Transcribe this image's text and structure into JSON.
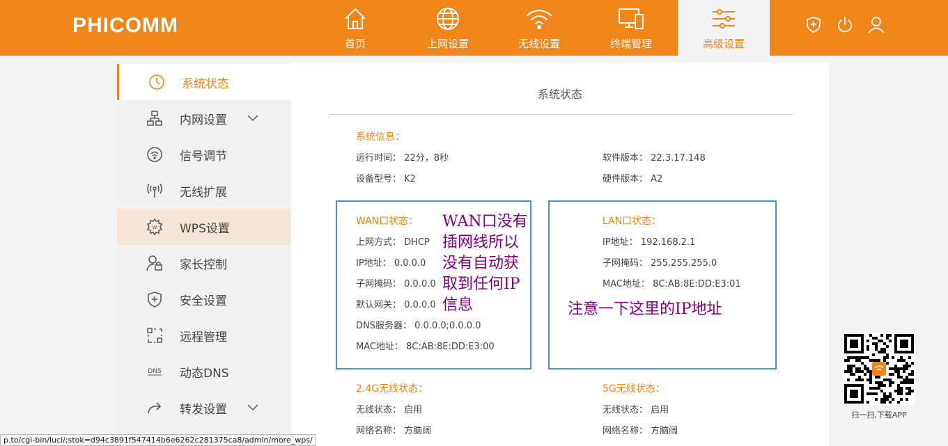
{
  "brand": {
    "logo": "PHICOMM",
    "accent": "#f08519"
  },
  "nav": [
    {
      "label": "首页",
      "icon": "home-icon"
    },
    {
      "label": "上网设置",
      "icon": "globe-icon"
    },
    {
      "label": "无线设置",
      "icon": "wifi-icon"
    },
    {
      "label": "终端管理",
      "icon": "devices-icon"
    },
    {
      "label": "高级设置",
      "icon": "sliders-icon",
      "active": true
    }
  ],
  "header_icons": [
    "shield-icon",
    "power-icon",
    "user-icon"
  ],
  "sidebar": [
    {
      "label": "系统状态",
      "icon": "clock-icon",
      "active": true
    },
    {
      "label": "内网设置",
      "icon": "network-icon",
      "expandable": true
    },
    {
      "label": "信号调节",
      "icon": "signal-icon"
    },
    {
      "label": "无线扩展",
      "icon": "antenna-icon"
    },
    {
      "label": "WPS设置",
      "icon": "gear-icon",
      "hover": true
    },
    {
      "label": "家长控制",
      "icon": "parent-lock-icon"
    },
    {
      "label": "安全设置",
      "icon": "shield-plus-icon"
    },
    {
      "label": "远程管理",
      "icon": "remote-icon"
    },
    {
      "label": "动态DNS",
      "icon": "dns-icon"
    },
    {
      "label": "转发设置",
      "icon": "forward-icon",
      "expandable": true
    }
  ],
  "main": {
    "title": "系统状态",
    "system_info": {
      "title": "系统信息：",
      "uptime_label": "运行时间：",
      "uptime_value": "22分，8秒",
      "model_label": "设备型号：",
      "model_value": "K2",
      "software_label": "软件版本：",
      "software_value": "22.3.17.148",
      "hardware_label": "硬件版本：",
      "hardware_value": "A2"
    },
    "wan": {
      "title": "WAN口状态：",
      "mode_label": "上网方式：",
      "mode_value": "DHCP",
      "ip_label": "IP地址：",
      "ip_value": "0.0.0.0",
      "mask_label": "子网掩码：",
      "mask_value": "0.0.0.0",
      "gateway_label": "默认网关：",
      "gateway_value": "0.0.0.0",
      "dns_label": "DNS服务器：",
      "dns_value": "0.0.0.0;0.0.0.0",
      "mac_label": "MAC地址：",
      "mac_value": "8C:AB:8E:DD:E3:00"
    },
    "lan": {
      "title": "LAN口状态：",
      "ip_label": "IP地址：",
      "ip_value": "192.168.2.1",
      "mask_label": "子网掩码：",
      "mask_value": "255.255.255.0",
      "mac_label": "MAC地址：",
      "mac_value": "8C:AB:8E:DD:E3:01"
    },
    "wifi24": {
      "title": "2.4G无线状态：",
      "status_label": "无线状态：",
      "status_value": "启用",
      "ssid_label": "网络名称：",
      "ssid_value": "方脑阔"
    },
    "wifi5": {
      "title": "5G无线状态：",
      "status_label": "无线状态：",
      "status_value": "启用",
      "ssid_label": "网络名称：",
      "ssid_value": "方脑阔"
    }
  },
  "annotations": {
    "wan_note_lines": [
      "WAN口没有",
      "插网线所以",
      "没有自动获",
      "取到任何IP",
      "信息"
    ],
    "lan_note": "注意一下这里的IP地址",
    "box_color": "#4a90d0",
    "text_color": "#800080"
  },
  "qr": {
    "caption": "扫一扫,下载APP"
  },
  "statusbar": {
    "url": "p.to/cgi-bin/luci/;stok=d94c3891f547414b6e6262c281375ca8/admin/more_wps/"
  }
}
